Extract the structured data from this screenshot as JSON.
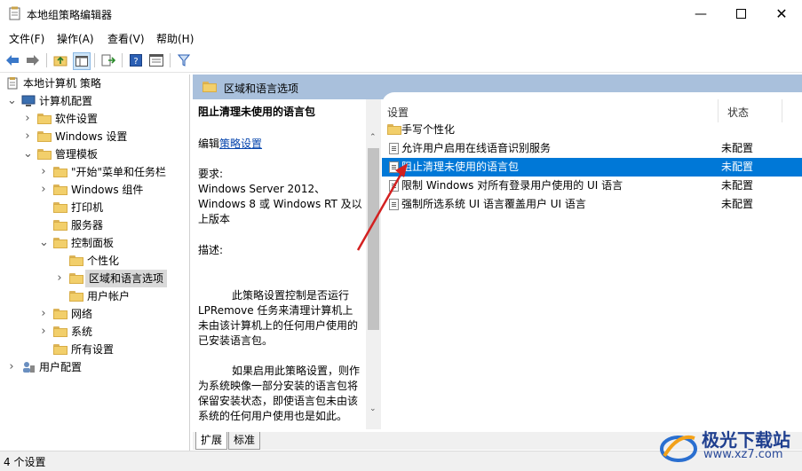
{
  "window": {
    "title": "本地组策略编辑器",
    "buttons": [
      "minimize",
      "maximize",
      "close"
    ]
  },
  "menu": [
    "文件(F)",
    "操作(A)",
    "查看(V)",
    "帮助(H)"
  ],
  "toolbar": {
    "icons": [
      "back-icon",
      "forward-icon",
      "up-folder-icon",
      "show-hide-tree-icon",
      "export-list-icon",
      "help-icon",
      "properties-icon",
      "filter-icon"
    ]
  },
  "tree": {
    "root": "本地计算机 策略",
    "items": [
      {
        "label": "计算机配置",
        "depth": 1,
        "expanded": true
      },
      {
        "label": "软件设置",
        "depth": 2
      },
      {
        "label": "Windows 设置",
        "depth": 2
      },
      {
        "label": "管理模板",
        "depth": 2,
        "expanded": true
      },
      {
        "label": "\"开始\"菜单和任务栏",
        "depth": 3
      },
      {
        "label": "Windows 组件",
        "depth": 3
      },
      {
        "label": "打印机",
        "depth": 3
      },
      {
        "label": "服务器",
        "depth": 3
      },
      {
        "label": "控制面板",
        "depth": 3,
        "expanded": true
      },
      {
        "label": "个性化",
        "depth": 4
      },
      {
        "label": "区域和语言选项",
        "depth": 4,
        "selected": true
      },
      {
        "label": "用户帐户",
        "depth": 4
      },
      {
        "label": "网络",
        "depth": 3
      },
      {
        "label": "系统",
        "depth": 3
      },
      {
        "label": "所有设置",
        "depth": 3
      },
      {
        "label": "用户配置",
        "depth": 1
      }
    ]
  },
  "header": {
    "title": "区域和语言选项"
  },
  "description": {
    "title": "阻止清理未使用的语言包",
    "edit_prefix": "编辑",
    "edit_link": "策略设置",
    "requires_label": "要求:",
    "requires_text": "Windows Server 2012、Windows 8 或 Windows RT 及以上版本",
    "desc_label": "描述:",
    "paragraph1": "此策略设置控制是否运行 LPRemove 任务来清理计算机上未由该计算机上的任何用户使用的已安装语言包。",
    "paragraph2": "如果启用此策略设置，则作为系统映像一部分安装的语言包将保留安装状态，即使语言包未由该系统的任何用户使用也是如此。"
  },
  "list": {
    "columns": {
      "setting": "设置",
      "state": "状态"
    },
    "folder_row": "手写个性化",
    "rows": [
      {
        "name": "允许用户启用在线语音识别服务",
        "state": "未配置",
        "selected": false
      },
      {
        "name": "阻止清理未使用的语言包",
        "state": "未配置",
        "selected": true
      },
      {
        "name": "限制 Windows 对所有登录用户使用的 UI 语言",
        "state": "未配置",
        "selected": false
      },
      {
        "name": "强制所选系统 UI 语言覆盖用户 UI 语言",
        "state": "未配置",
        "selected": false
      }
    ]
  },
  "tabs": [
    "扩展",
    "标准"
  ],
  "status": {
    "text": "4 个设置"
  },
  "watermark": {
    "line1": "极光下载站",
    "line2": "www.xz7.com"
  },
  "colors": {
    "selection": "#0078d7",
    "header_band": "#a9c0dc",
    "arrow": "#d32020"
  }
}
